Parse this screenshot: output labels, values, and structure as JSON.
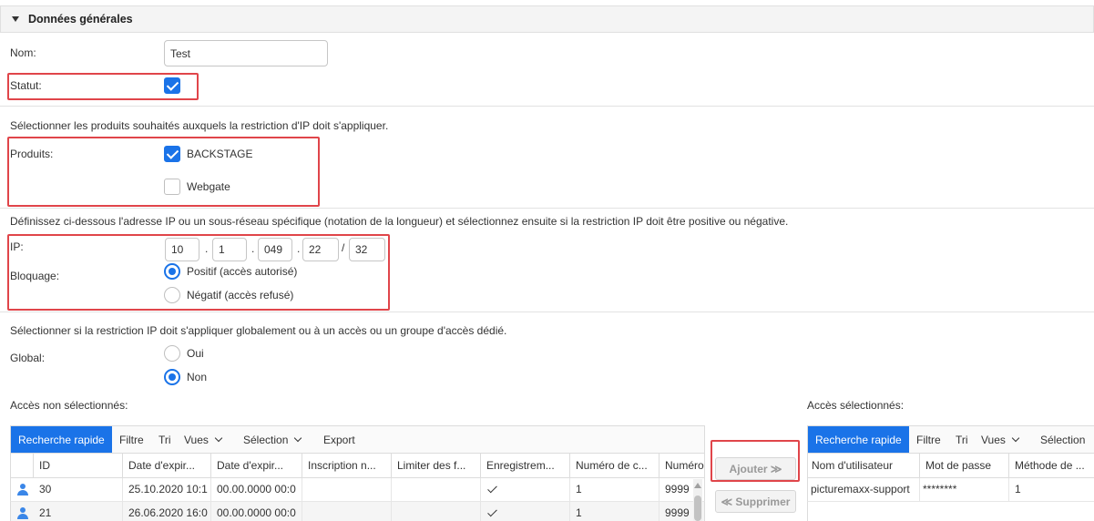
{
  "section": {
    "title": "Données générales"
  },
  "fields": {
    "nom_label": "Nom:",
    "nom_value": "Test",
    "statut_label": "Statut:",
    "produits_intro": "Sélectionner les produits souhaités auxquels la restriction d'IP doit s'appliquer.",
    "produits_label": "Produits:",
    "produit_backstage": "BACKSTAGE",
    "produit_webgate": "Webgate",
    "ip_intro": "Définissez ci-dessous l'adresse IP ou un sous-réseau spécifique (notation de la longueur) et sélectionnez ensuite si la restriction IP doit être positive ou négative.",
    "ip_label": "IP:",
    "ip": {
      "o1": "10",
      "o2": "1",
      "o3": "049",
      "o4": "22",
      "mask": "32",
      "dot": ".",
      "slash": "/"
    },
    "bloquage_label": "Bloquage:",
    "bloquage_positif": "Positif (accès autorisé)",
    "bloquage_negatif": "Négatif (accès refusé)",
    "global_intro": "Sélectionner si la restriction IP doit s'appliquer globalement ou à un accès ou un groupe d'accès dédié.",
    "global_label": "Global:",
    "global_oui": "Oui",
    "global_non": "Non"
  },
  "left_grid": {
    "title": "Accès non sélectionnés:",
    "toolbar": {
      "quick_search": "Recherche rapide",
      "filtre": "Filtre",
      "tri": "Tri",
      "vues": "Vues",
      "selection": "Sélection",
      "export": "Export"
    },
    "headers": [
      "ID",
      "Date d'expir...",
      "Date d'expir...",
      "Inscription n...",
      "Limiter des f...",
      "Enregistrem...",
      "Numéro de c...",
      "Numéro"
    ],
    "rows": [
      {
        "id": "30",
        "date1": "25.10.2020 10:1",
        "date2": "00.00.0000 00:0",
        "num_c": "1",
        "numero": "9999"
      },
      {
        "id": "21",
        "date1": "26.06.2020 16:0",
        "date2": "00.00.0000 00:0",
        "num_c": "1",
        "numero": "9999"
      }
    ]
  },
  "buttons": {
    "ajouter": "Ajouter ≫",
    "supprimer": "≪ Supprimer"
  },
  "right_grid": {
    "title": "Accès sélectionnés:",
    "toolbar": {
      "quick_search": "Recherche rapide",
      "filtre": "Filtre",
      "tri": "Tri",
      "vues": "Vues",
      "selection": "Sélection"
    },
    "headers": [
      "Nom d'utilisateur",
      "Mot de passe",
      "Méthode de ..."
    ],
    "rows": [
      {
        "user": "picturemaxx-support",
        "password": "********",
        "method": "1"
      }
    ]
  },
  "colors": {
    "accent": "#1a73e8",
    "highlight": "#e0454a"
  }
}
